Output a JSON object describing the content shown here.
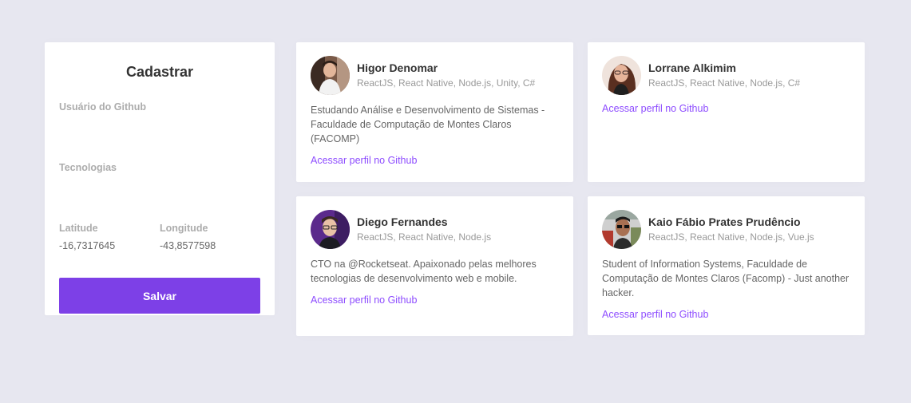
{
  "form": {
    "title": "Cadastrar",
    "github_label": "Usuário do Github",
    "github_value": "",
    "techs_label": "Tecnologias",
    "techs_value": "",
    "latitude_label": "Latitude",
    "latitude_value": "-16,7317645",
    "longitude_label": "Longitude",
    "longitude_value": "-43,8577598",
    "save_label": "Salvar"
  },
  "colors": {
    "background": "#e7e7f0",
    "accent": "#7d40e7",
    "link": "#8e4dff"
  },
  "devs": [
    {
      "name": "Higor Denomar",
      "techs": "ReactJS, React Native, Node.js, Unity, C#",
      "bio": "Estudando Análise e Desenvolvimento de Sistemas - Faculdade de Computação de Montes Claros (FACOMP)",
      "link": "Acessar perfil no Github"
    },
    {
      "name": "Lorrane Alkimim",
      "techs": "ReactJS, React Native, Node.js, C#",
      "bio": "",
      "link": "Acessar perfil no Github"
    },
    {
      "name": "Diego Fernandes",
      "techs": "ReactJS, React Native, Node.js",
      "bio": "CTO na @Rocketseat. Apaixonado pelas melhores tecnologias de desenvolvimento web e mobile.",
      "link": "Acessar perfil no Github"
    },
    {
      "name": "Kaio Fábio Prates Prudêncio",
      "techs": "ReactJS, React Native, Node.js, Vue.js",
      "bio": "Student of Information Systems, Faculdade de Computação de Montes Claros (Facomp) - Just another hacker.",
      "link": "Acessar perfil no Github"
    }
  ]
}
